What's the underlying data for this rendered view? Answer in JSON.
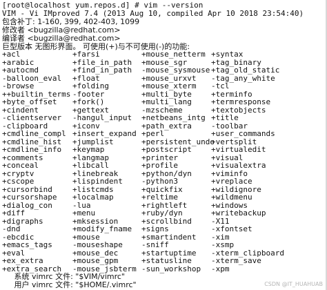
{
  "terminal": {
    "prompt_user_host": "[root@localhost yum.repos.d]",
    "prompt_symbol": "#",
    "command": "vim --version",
    "version_line": "VIM - Vi IMproved 7.4 (2013 Aug 10, compiled Apr 10 2018 23:54:40)",
    "patches_line": "包含补丁: 1-160, 399, 402-403, 1099",
    "modified_by_line": "修改者 <bugzilla@redhat.com>",
    "compiled_by_line": "编译者 <bugzilla@redhat.com>",
    "features_header": "巨型版本 无图形界面。 可使用(+)与不可使用(-)的功能:",
    "features": [
      [
        "+acl",
        "+farsi",
        "+mouse_netterm",
        "+syntax"
      ],
      [
        "+arabic",
        "+file_in_path",
        "+mouse_sgr",
        "+tag_binary"
      ],
      [
        "+autocmd",
        "+find_in_path",
        "-mouse_sysmouse",
        "+tag_old_static"
      ],
      [
        "-balloon_eval",
        "+float",
        "+mouse_urxvt",
        "-tag_any_white"
      ],
      [
        "-browse",
        "+folding",
        "+mouse_xterm",
        "-tcl"
      ],
      [
        "++builtin_terms",
        "-footer",
        "+multi_byte",
        "+terminfo"
      ],
      [
        "+byte_offset",
        "+fork()",
        "+multi_lang",
        "+termresponse"
      ],
      [
        "+cindent",
        "+gettext",
        "-mzscheme",
        "+textobjects"
      ],
      [
        "-clientserver",
        "-hangul_input",
        "+netbeans_intg",
        "+title"
      ],
      [
        "-clipboard",
        "+iconv",
        "+path_extra",
        "-toolbar"
      ],
      [
        "+cmdline_compl",
        "+insert_expand",
        "+perl",
        "+user_commands"
      ],
      [
        "+cmdline_hist",
        "+jumplist",
        "+persistent_undo",
        "+vertsplit"
      ],
      [
        "+cmdline_info",
        "+keymap",
        "+postscript",
        "+virtualedit"
      ],
      [
        "+comments",
        "+langmap",
        "+printer",
        "+visual"
      ],
      [
        "+conceal",
        "+libcall",
        "+profile",
        "+visualextra"
      ],
      [
        "+cryptv",
        "+linebreak",
        "+python/dyn",
        "+viminfo"
      ],
      [
        "+cscope",
        "+lispindent",
        "-python3",
        "+vreplace"
      ],
      [
        "+cursorbind",
        "+listcmds",
        "+quickfix",
        "+wildignore"
      ],
      [
        "+cursorshape",
        "+localmap",
        "+reltime",
        "+wildmenu"
      ],
      [
        "+dialog_con",
        "-lua",
        "+rightleft",
        "+windows"
      ],
      [
        "+diff",
        "+menu",
        "+ruby/dyn",
        "+writebackup"
      ],
      [
        "+digraphs",
        "+mksession",
        "+scrollbind",
        "-X11"
      ],
      [
        "-dnd",
        "+modify_fname",
        "+signs",
        "-xfontset"
      ],
      [
        "-ebcdic",
        "+mouse",
        "+smartindent",
        "-xim"
      ],
      [
        "+emacs_tags",
        "-mouseshape",
        "-sniff",
        "-xsmp"
      ],
      [
        "+eval",
        "+mouse_dec",
        "+startuptime",
        "-xterm_clipboard"
      ],
      [
        "+ex_extra",
        "+mouse_gpm",
        "+statusline",
        "-xterm_save"
      ],
      [
        "+extra_search",
        "-mouse_jsbterm",
        "-sun_workshop",
        "-xpm"
      ]
    ],
    "system_vimrc_line": "     系统 vimrc 文件: \"$VIM/vimrc\"",
    "user_vimrc_line": "     用户 vimrc 文件: \"$HOME/.vimrc\"",
    "watermark": "CSDN @IT_HUAHUAB"
  }
}
